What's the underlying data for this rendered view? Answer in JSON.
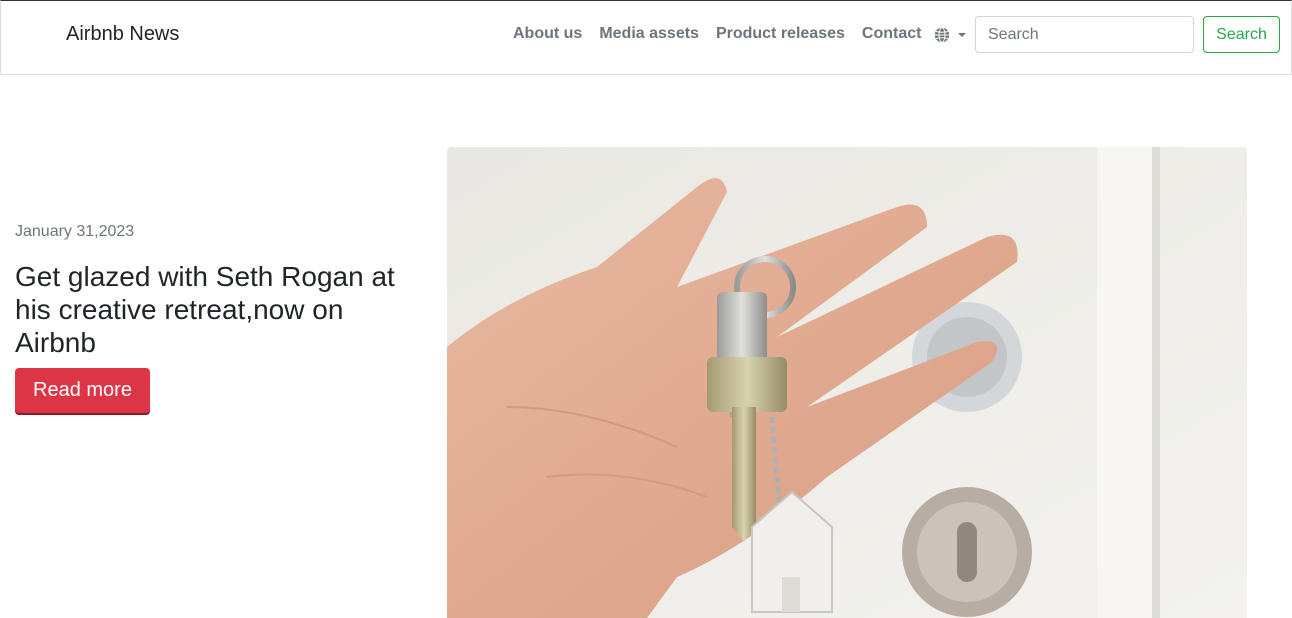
{
  "navbar": {
    "brand": "Airbnb News",
    "links": [
      "About us",
      "Media assets",
      "Product releases",
      "Contact"
    ],
    "language_icon": "globe-icon",
    "search": {
      "placeholder": "Search",
      "value": "",
      "button_label": "Search"
    }
  },
  "article": {
    "date": "January 31,2023",
    "title": "Get glazed with Seth Rogan at his creative retreat,now on Airbnb",
    "cta_label": "Read more",
    "image_subject": "hand-holding-keys-image"
  },
  "colors": {
    "cta": "#dc3545",
    "search_button": "#28a745",
    "nav_link": "#6c757d",
    "text": "#212529"
  }
}
